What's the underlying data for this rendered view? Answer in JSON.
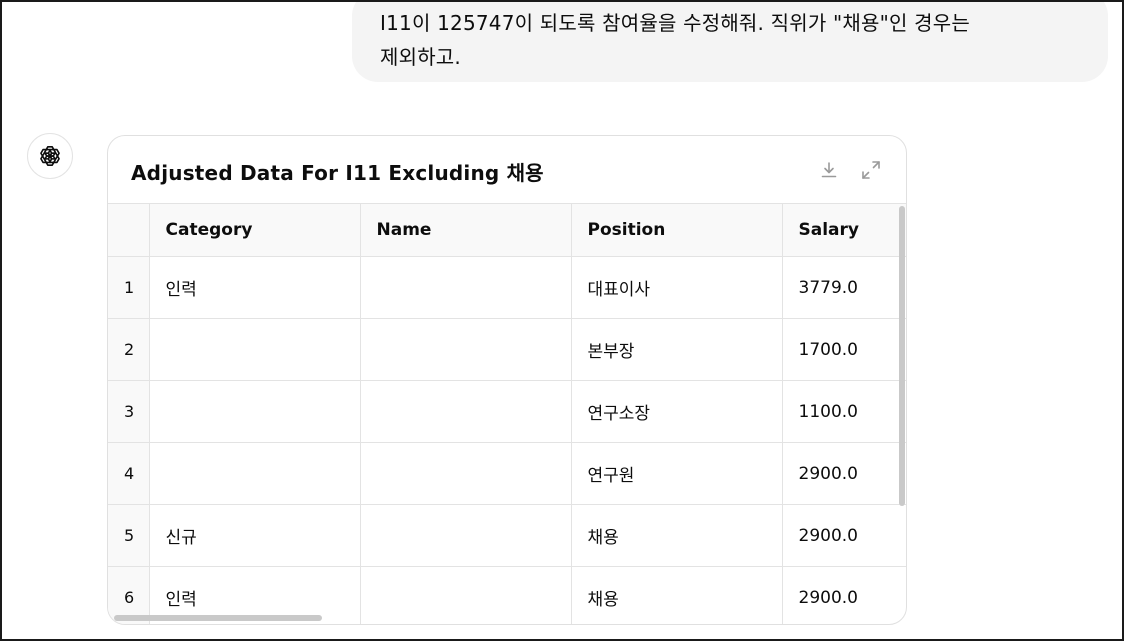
{
  "user_message": {
    "line1": "I11이 125747이 되도록 참여율을 수정해줘. 직위가 \"채용\"인 경우는",
    "line2": "제외하고."
  },
  "assistant": {
    "avatar_icon": "openai-logo-icon"
  },
  "card": {
    "title": "Adjusted Data For I11 Excluding 채용",
    "download_icon": "download-icon",
    "expand_icon": "expand-icon"
  },
  "table": {
    "columns": [
      "",
      "Category",
      "Name",
      "Position",
      "Salary"
    ],
    "rows": [
      {
        "index": "1",
        "category": "인력",
        "name": "",
        "position": "대표이사",
        "salary": "3779.0"
      },
      {
        "index": "2",
        "category": "",
        "name": "",
        "position": "본부장",
        "salary": "1700.0"
      },
      {
        "index": "3",
        "category": "",
        "name": "",
        "position": "연구소장",
        "salary": "1100.0"
      },
      {
        "index": "4",
        "category": "",
        "name": "",
        "position": "연구원",
        "salary": "2900.0"
      },
      {
        "index": "5",
        "category": "신규",
        "name": "",
        "position": "채용",
        "salary": "2900.0"
      },
      {
        "index": "6",
        "category": "인력",
        "name": "",
        "position": "채용",
        "salary": "2900.0"
      }
    ]
  },
  "colors": {
    "bubble_bg": "#f4f4f4",
    "header_bg": "#f9f9f9",
    "border": "#e3e3e3",
    "scrollbar": "#c9c9c9"
  }
}
